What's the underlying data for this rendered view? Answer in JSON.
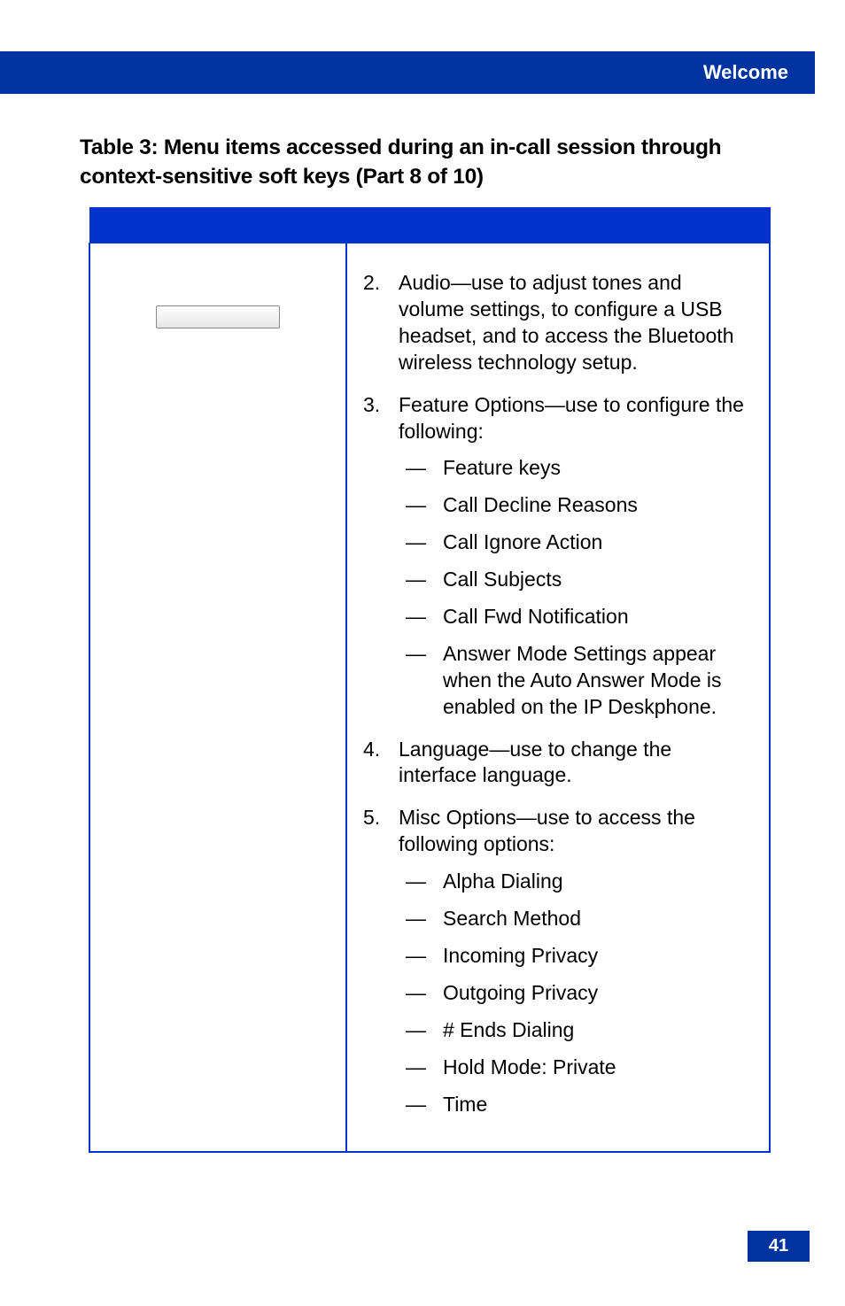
{
  "header": {
    "section": "Welcome"
  },
  "table": {
    "title": "Table 3: Menu items accessed during an in-call session through context-sensitive soft keys (Part 8 of 10)",
    "items": [
      {
        "num": 2,
        "text": "Audio—use to adjust tones and volume settings, to configure a USB headset, and to access the Bluetooth wireless technology setup."
      },
      {
        "num": 3,
        "text": "Feature Options—use to configure the following:",
        "sub": [
          "Feature keys",
          "Call Decline Reasons",
          "Call Ignore Action",
          "Call Subjects",
          "Call Fwd Notification",
          "Answer Mode Settings appear when the Auto Answer Mode is enabled on the IP Deskphone."
        ]
      },
      {
        "num": 4,
        "text": "Language—use to change the interface language."
      },
      {
        "num": 5,
        "text": "Misc Options—use to access the following options:",
        "sub": [
          "Alpha Dialing",
          "Search Method",
          "Incoming Privacy",
          "Outgoing Privacy",
          "# Ends Dialing",
          "Hold Mode: Private",
          "Time"
        ]
      }
    ]
  },
  "page_number": "41"
}
